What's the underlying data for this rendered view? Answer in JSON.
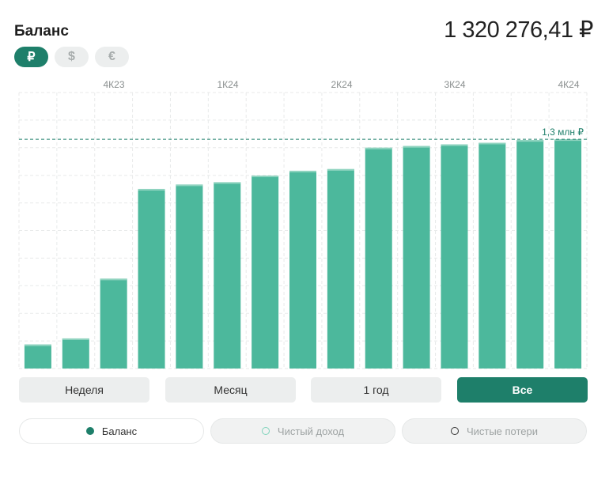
{
  "header": {
    "title": "Баланс",
    "total": "1 320 276,41 ₽"
  },
  "currencies": [
    {
      "symbol": "₽",
      "active": true
    },
    {
      "symbol": "$",
      "active": false
    },
    {
      "symbol": "€",
      "active": false
    }
  ],
  "periods": [
    {
      "label": "Неделя",
      "active": false
    },
    {
      "label": "Месяц",
      "active": false
    },
    {
      "label": "1 год",
      "active": false
    },
    {
      "label": "Все",
      "active": true
    }
  ],
  "legend": [
    {
      "label": "Баланс",
      "icon": "filled-dot-icon",
      "active": true
    },
    {
      "label": "Чистый доход",
      "icon": "ring-dot-icon",
      "active": false
    },
    {
      "label": "Чистые потери",
      "icon": "ring-dot-icon",
      "active": false
    }
  ],
  "colors": {
    "accent": "#1e7f6a",
    "bar": "#4cb89c",
    "bar_top": "#8fd3bf"
  },
  "chart_data": {
    "type": "bar",
    "x_tick_labels": [
      "4К23",
      "1К24",
      "2К24",
      "3К24",
      "4К24"
    ],
    "values": [
      0.174,
      0.218,
      0.651,
      1.301,
      1.333,
      1.35,
      1.398,
      1.433,
      1.445,
      1.6,
      1.612,
      1.624,
      1.636,
      1.655,
      1.661
    ],
    "reference_line": {
      "value": 1.661,
      "label": "1,3 млн ₽"
    },
    "ylim": [
      0,
      2.0
    ],
    "grid": true
  }
}
